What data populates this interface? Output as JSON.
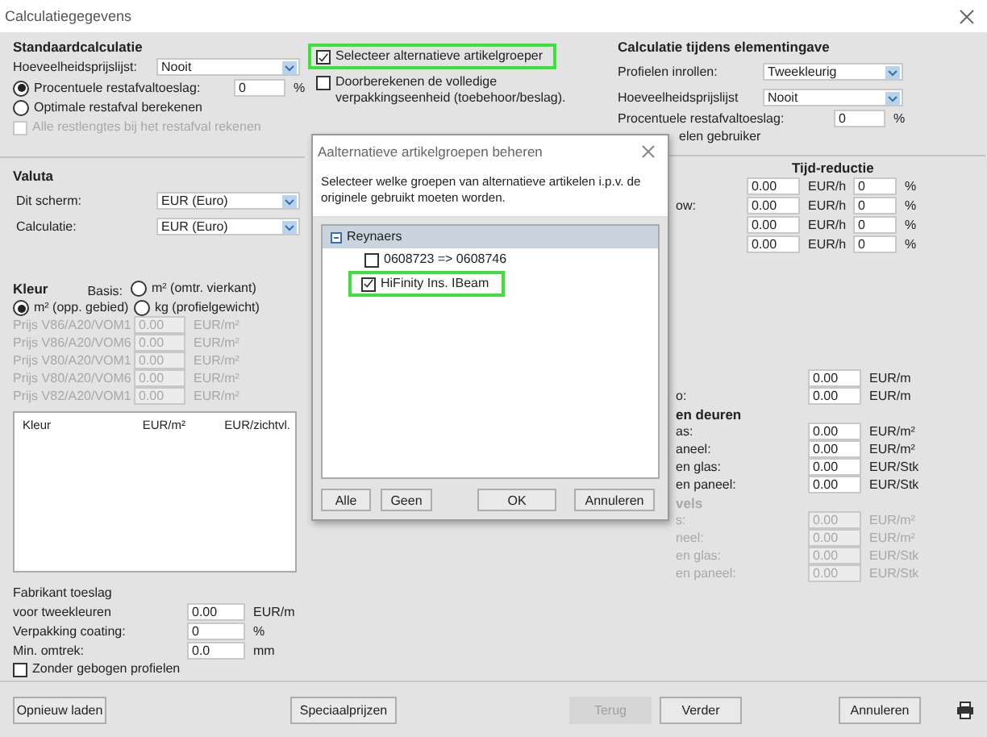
{
  "window": {
    "title": "Calculatiegegevens"
  },
  "standard": {
    "title": "Standaardcalculatie",
    "price_list": {
      "label": "Hoeveelheidsprijslijst:",
      "value": "Nooit"
    },
    "waste_options": [
      {
        "label": "Procentuele restafvaltoeslag:",
        "selected": true,
        "value": "0",
        "unit": "%"
      },
      {
        "label": "Optimale restafval berekenen",
        "selected": false
      }
    ],
    "all_lengths": {
      "label": "Alle restlengtes bij het restafval rekenen",
      "checked": false,
      "disabled": true
    }
  },
  "middle_options": [
    {
      "label": "Selecteer alternatieve artikelgroeper",
      "checked": true,
      "highlighted": true
    },
    {
      "label": "Doorberekenen de volledige verpakkingseenheid (toebehoor/beslag).",
      "checked": false,
      "highlighted": false
    }
  ],
  "valuta": {
    "title": "Valuta",
    "rows": [
      {
        "label": "Dit scherm:",
        "value": "EUR (Euro)"
      },
      {
        "label": "Calculatie:",
        "value": "EUR (Euro)"
      }
    ]
  },
  "kleur": {
    "title": "Kleur",
    "basis_label": "Basis:",
    "basis_options": [
      {
        "label": "m² (omtr. vierkant)",
        "selected": false
      },
      {
        "label": "m² (opp. gebied)",
        "selected": true
      },
      {
        "label": "kg (profielgewicht)",
        "selected": false
      }
    ],
    "prices": [
      {
        "label": "Prijs V86/A20/VOM1",
        "value": "0.00",
        "unit": "EUR/m²",
        "disabled": true
      },
      {
        "label": "Prijs V86/A20/VOM6",
        "value": "0.00",
        "unit": "EUR/m²",
        "disabled": true
      },
      {
        "label": "Prijs V80/A20/VOM1",
        "value": "0.00",
        "unit": "EUR/m²",
        "disabled": true
      },
      {
        "label": "Prijs V80/A20/VOM6",
        "value": "0.00",
        "unit": "EUR/m²",
        "disabled": true
      },
      {
        "label": "Prijs V82/A20/VOM1",
        "value": "0.00",
        "unit": "EUR/m²",
        "disabled": true
      }
    ],
    "table": {
      "columns": [
        "Kleur",
        "EUR/m²",
        "EUR/zichtvl."
      ]
    }
  },
  "extras": {
    "title": "Fabrikant toeslag",
    "rows": [
      {
        "label": "voor tweekleuren",
        "value": "0.00",
        "unit": "EUR/m"
      },
      {
        "label": "Verpakking coating:",
        "value": "0",
        "unit": "%"
      },
      {
        "label": "Min. omtrek:",
        "value": "0.0",
        "unit": "mm"
      }
    ],
    "no_bent": {
      "label": "Zonder gebogen profielen",
      "checked": false
    }
  },
  "element_calc": {
    "title": "Calculatie tijdens elementingave",
    "dropdowns": [
      {
        "label": "Profielen inrollen:",
        "value": "Tweekleurig"
      },
      {
        "label": "Hoeveelheidsprijslijst",
        "value": "Nooit"
      }
    ],
    "waste": {
      "label": "Procentuele restafvaltoeslag:",
      "value": "0",
      "unit": "%"
    },
    "partial_option": "elen gebruiker"
  },
  "time_reduction": {
    "title": "Tijd-reductie",
    "rows": [
      {
        "cost": "0.00",
        "cost_unit": "EUR/h",
        "percent": "0",
        "percent_unit": "%"
      },
      {
        "label": "ow:",
        "cost": "0.00",
        "cost_unit": "EUR/h",
        "percent": "0",
        "percent_unit": "%"
      },
      {
        "cost": "0.00",
        "cost_unit": "EUR/h",
        "percent": "0",
        "percent_unit": "%"
      },
      {
        "cost": "0.00",
        "cost_unit": "EUR/h",
        "percent": "0",
        "percent_unit": "%"
      }
    ]
  },
  "lower_groups": [
    {
      "disabled": false,
      "rows": [
        {
          "value": "0.00",
          "unit": "EUR/m"
        },
        {
          "label": "o:",
          "value": "0.00",
          "unit": "EUR/m"
        }
      ]
    },
    {
      "title": "en deuren",
      "disabled": false,
      "rows": [
        {
          "label": "as:",
          "value": "0.00",
          "unit": "EUR/m²"
        },
        {
          "label": "aneel:",
          "value": "0.00",
          "unit": "EUR/m²"
        },
        {
          "label": "en glas:",
          "value": "0.00",
          "unit": "EUR/Stk"
        },
        {
          "label": "en paneel:",
          "value": "0.00",
          "unit": "EUR/Stk"
        }
      ]
    },
    {
      "title": "vels",
      "disabled": true,
      "rows": [
        {
          "label": "s:",
          "value": "0.00",
          "unit": "EUR/m²"
        },
        {
          "label": "neel:",
          "value": "0.00",
          "unit": "EUR/m²"
        },
        {
          "label": "en glas:",
          "value": "0.00",
          "unit": "EUR/Stk"
        },
        {
          "label": "en paneel:",
          "value": "0.00",
          "unit": "EUR/Stk"
        }
      ]
    }
  ],
  "dialog": {
    "title": "Aalternatieve artikelgroepen beheren",
    "description": "Selecteer welke groepen van alternatieve artikelen i.p.v. de originele gebruikt moeten worden.",
    "tree": {
      "label": "Reynaers",
      "expanded": true,
      "children": [
        {
          "label": "0608723 => 0608746",
          "checked": false,
          "highlighted": false
        },
        {
          "label": "HiFinity Ins. IBeam",
          "checked": true,
          "highlighted": true
        }
      ]
    },
    "buttons": [
      {
        "label": "Alle"
      },
      {
        "label": "Geen"
      },
      {
        "label": "OK"
      },
      {
        "label": "Annuleren"
      }
    ]
  },
  "footer": {
    "buttons": [
      {
        "label": "Opnieuw laden",
        "disabled": false
      },
      {
        "label": "Speciaalprijzen",
        "disabled": false
      },
      {
        "label": "Terug",
        "disabled": true
      },
      {
        "label": "Verder",
        "disabled": false
      },
      {
        "label": "Annuleren",
        "disabled": false
      }
    ]
  }
}
